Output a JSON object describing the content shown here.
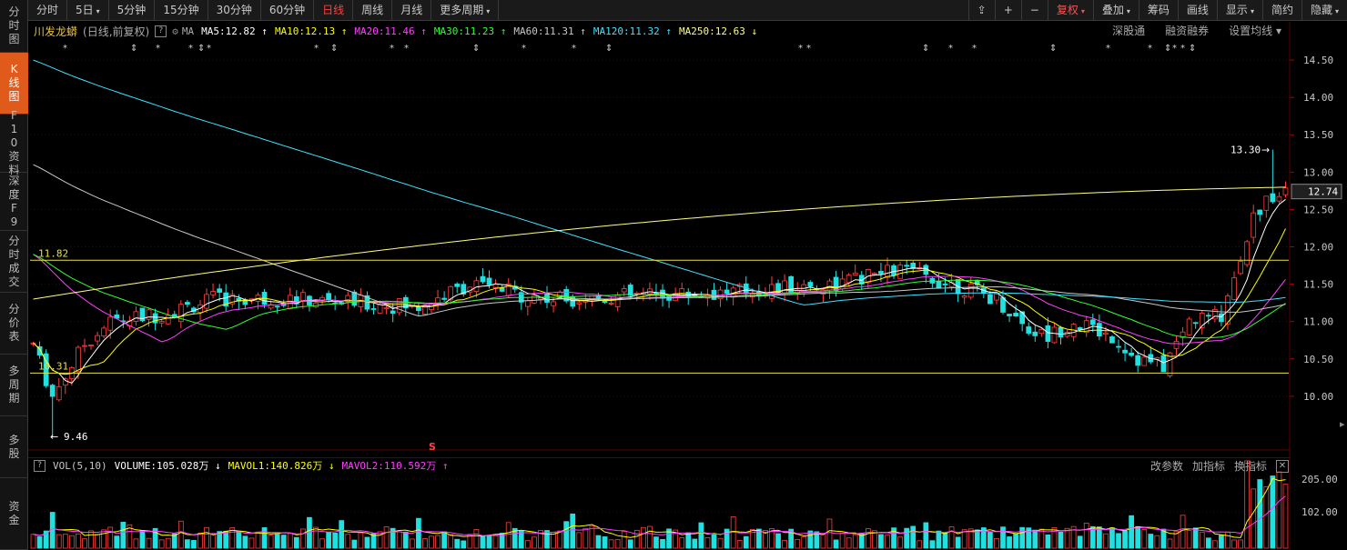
{
  "sidebar": [
    {
      "label": "分时图",
      "name": "sidebar-item-timeshare",
      "active": false,
      "h": 58
    },
    {
      "label": "K线图",
      "name": "sidebar-item-kline",
      "active": true,
      "h": 68
    },
    {
      "label": "F10资料",
      "name": "sidebar-item-f10",
      "active": false,
      "h": 64
    },
    {
      "label": "深度F9",
      "name": "sidebar-item-depth",
      "active": false,
      "h": 64
    },
    {
      "label": "分时成交",
      "name": "sidebar-item-trades",
      "active": false,
      "h": 68
    },
    {
      "label": "分价表",
      "name": "sidebar-item-price-table",
      "active": false,
      "h": 68
    },
    {
      "label": "多周期",
      "name": "sidebar-item-multi-period",
      "active": false,
      "h": 68
    },
    {
      "label": "多股",
      "name": "sidebar-item-multi-stock",
      "active": false,
      "h": 68
    },
    {
      "label": "资金",
      "name": "sidebar-item-funds",
      "active": false,
      "h": 79
    }
  ],
  "toolbar": {
    "periods": [
      {
        "label": "分时",
        "caret": false,
        "active": false
      },
      {
        "label": "5日",
        "caret": true,
        "active": false
      },
      {
        "label": "5分钟",
        "caret": false,
        "active": false
      },
      {
        "label": "15分钟",
        "caret": false,
        "active": false
      },
      {
        "label": "30分钟",
        "caret": false,
        "active": false
      },
      {
        "label": "60分钟",
        "caret": false,
        "active": false
      },
      {
        "label": "日线",
        "caret": false,
        "active": true
      },
      {
        "label": "周线",
        "caret": false,
        "active": false
      },
      {
        "label": "月线",
        "caret": false,
        "active": false
      },
      {
        "label": "更多周期",
        "caret": true,
        "active": false
      }
    ],
    "right": [
      {
        "label": "⇪",
        "name": "lock-icon",
        "caret": false,
        "red": false
      },
      {
        "label": "+",
        "name": "zoom-in-icon",
        "caret": false,
        "red": false
      },
      {
        "label": "−",
        "name": "zoom-out-icon",
        "caret": false,
        "red": false
      },
      {
        "label": "复权",
        "name": "adjust-button",
        "caret": true,
        "red": true
      },
      {
        "label": "叠加",
        "name": "overlay-button",
        "caret": true,
        "red": false
      },
      {
        "label": "筹码",
        "name": "chips-button",
        "caret": false,
        "red": false
      },
      {
        "label": "画线",
        "name": "draw-line-button",
        "caret": false,
        "red": false
      },
      {
        "label": "显示",
        "name": "display-button",
        "caret": true,
        "red": false
      },
      {
        "label": "简约",
        "name": "simple-button",
        "caret": false,
        "red": false
      },
      {
        "label": "隐藏",
        "name": "hide-button",
        "caret": true,
        "red": false
      }
    ]
  },
  "legend": {
    "title": "川发龙蟒",
    "subtitle": "(日线,前复权)",
    "q": "?",
    "ma_label": "MA",
    "items": [
      {
        "text": "MA5:12.82 ↑",
        "color": "#ffffff"
      },
      {
        "text": "MA10:12.13 ↑",
        "color": "#ffff00"
      },
      {
        "text": "MA20:11.46 ↑",
        "color": "#ff40ff"
      },
      {
        "text": "MA30:11.23 ↑",
        "color": "#30ff30"
      },
      {
        "text": "MA60:11.31 ↑",
        "color": "#c8c8c8"
      },
      {
        "text": "MA120:11.32 ↑",
        "color": "#40e0ff"
      },
      {
        "text": "MA250:12.63 ↓",
        "color": "#ffff80"
      }
    ],
    "right": [
      "深股通",
      "融资融券",
      "设置均线 ▾"
    ]
  },
  "price_axis": {
    "ticks": [
      "14.50",
      "14.00",
      "13.50",
      "13.00",
      "12.50",
      "12.00",
      "11.50",
      "11.00",
      "10.50",
      "10.00"
    ],
    "current": "12.74"
  },
  "annotations": {
    "high": "13.30",
    "low": "9.46",
    "line_high": "11.82",
    "line_low": "10.31",
    "marker": "S"
  },
  "volume": {
    "q": "?",
    "items": [
      {
        "text": "VOL(5,10)",
        "color": "#c8c8c8"
      },
      {
        "text": "VOLUME:105.028万 ↓",
        "color": "#ffffff"
      },
      {
        "text": "MAVOL1:140.826万 ↓",
        "color": "#ffff00"
      },
      {
        "text": "MAVOL2:110.592万 ↑",
        "color": "#ff40ff"
      }
    ],
    "right": [
      "改参数",
      "加指标",
      "换指标"
    ],
    "close": "✕",
    "ticks": [
      "205.00",
      "102.00"
    ]
  },
  "colors": {
    "up": "#ff4040",
    "down": "#20e0e0",
    "grid": "#5a0000"
  }
}
